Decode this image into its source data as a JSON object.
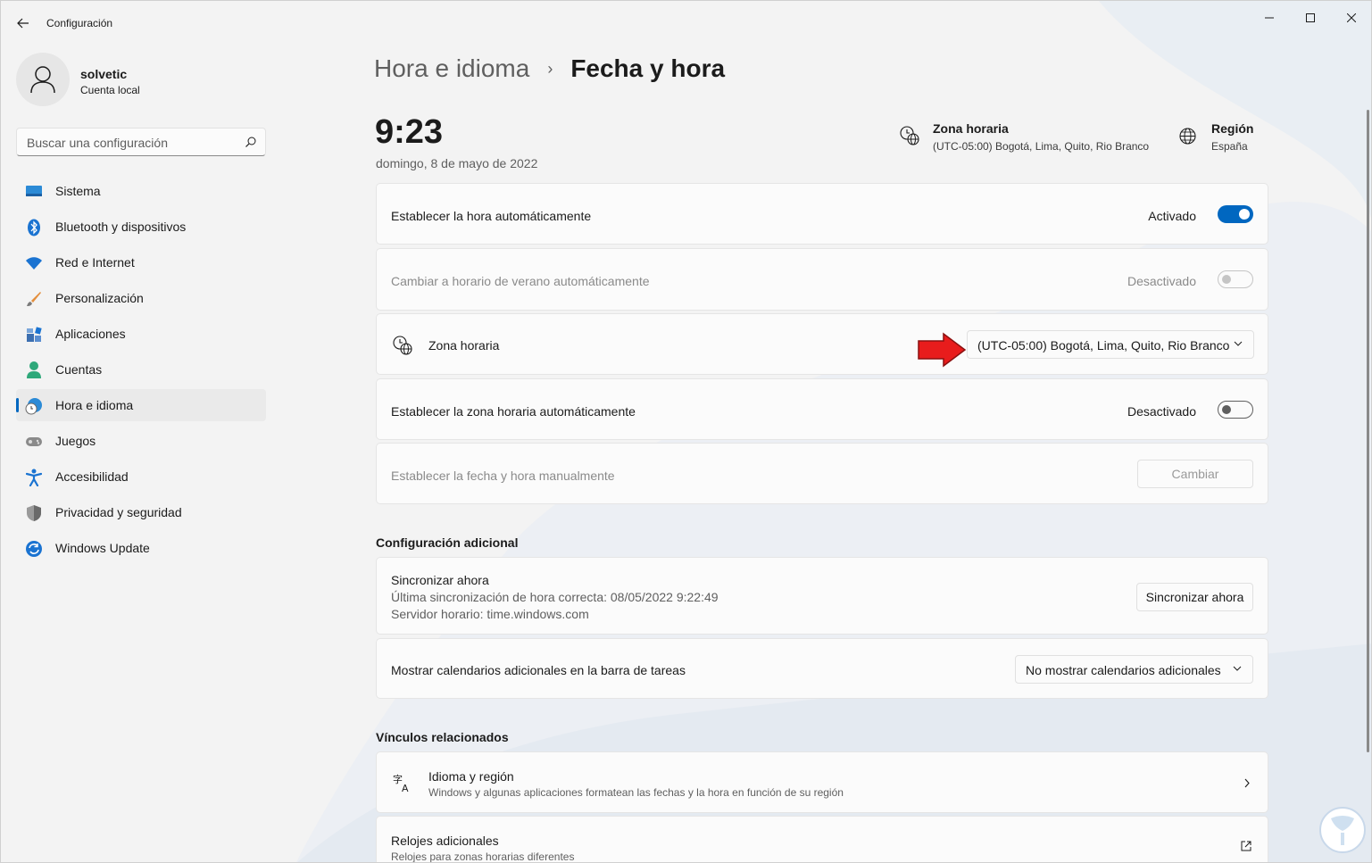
{
  "window": {
    "title": "Configuración"
  },
  "user": {
    "name": "solvetic",
    "account_type": "Cuenta local"
  },
  "search": {
    "placeholder": "Buscar una configuración"
  },
  "sidebar": {
    "items": [
      {
        "label": "Sistema",
        "icon": "monitor-icon"
      },
      {
        "label": "Bluetooth y dispositivos",
        "icon": "bluetooth-icon"
      },
      {
        "label": "Red e Internet",
        "icon": "wifi-icon"
      },
      {
        "label": "Personalización",
        "icon": "brush-icon"
      },
      {
        "label": "Aplicaciones",
        "icon": "apps-icon"
      },
      {
        "label": "Cuentas",
        "icon": "person-icon"
      },
      {
        "label": "Hora e idioma",
        "icon": "clock-globe-icon",
        "active": true
      },
      {
        "label": "Juegos",
        "icon": "gamepad-icon"
      },
      {
        "label": "Accesibilidad",
        "icon": "accessibility-icon"
      },
      {
        "label": "Privacidad y seguridad",
        "icon": "shield-icon"
      },
      {
        "label": "Windows Update",
        "icon": "update-icon"
      }
    ]
  },
  "breadcrumb": {
    "parent": "Hora e idioma",
    "separator": "›",
    "current": "Fecha y hora"
  },
  "clock": {
    "time": "9:23",
    "date": "domingo, 8 de mayo de 2022"
  },
  "header_info": {
    "timezone": {
      "title": "Zona horaria",
      "value": "(UTC-05:00) Bogotá, Lima, Quito, Rio Branco"
    },
    "region": {
      "title": "Región",
      "value": "España"
    }
  },
  "settings": {
    "auto_time": {
      "label": "Establecer la hora automáticamente",
      "state": "Activado"
    },
    "dst": {
      "label": "Cambiar a horario de verano automáticamente",
      "state": "Desactivado"
    },
    "timezone": {
      "label": "Zona horaria",
      "value": "(UTC-05:00) Bogotá, Lima, Quito, Rio Branco"
    },
    "auto_timezone": {
      "label": "Establecer la zona horaria automáticamente",
      "state": "Desactivado"
    },
    "manual": {
      "label": "Establecer la fecha y hora manualmente",
      "button": "Cambiar"
    }
  },
  "additional": {
    "title": "Configuración adicional",
    "sync": {
      "label": "Sincronizar ahora",
      "last_sync": "Última sincronización de hora correcta: 08/05/2022 9:22:49",
      "server": "Servidor horario: time.windows.com",
      "button": "Sincronizar ahora"
    },
    "calendars": {
      "label": "Mostrar calendarios adicionales en la barra de tareas",
      "value": "No mostrar calendarios adicionales"
    }
  },
  "related": {
    "title": "Vínculos relacionados",
    "language_region": {
      "label": "Idioma y región",
      "desc": "Windows y algunas aplicaciones formatean las fechas y la hora en función de su región"
    },
    "clocks": {
      "label": "Relojes adicionales",
      "desc": "Relojes para zonas horarias diferentes"
    }
  },
  "colors": {
    "accent": "#0067c0",
    "arrow": "#e81c1c"
  }
}
